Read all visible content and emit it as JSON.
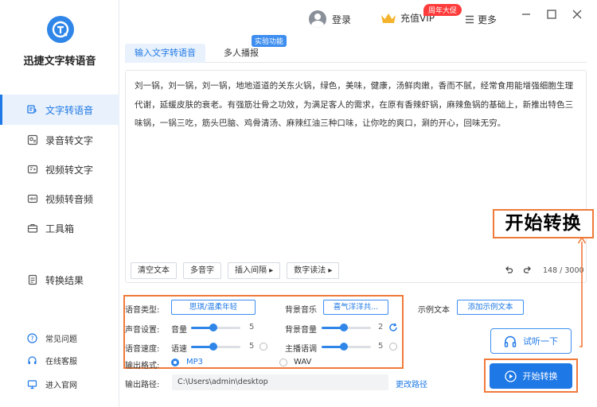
{
  "app": {
    "name": "迅捷文字转语音"
  },
  "sidebar": {
    "items": [
      {
        "label": "文字转语音",
        "active": true
      },
      {
        "label": "录音转文字"
      },
      {
        "label": "视频转文字"
      },
      {
        "label": "视频转音频"
      },
      {
        "label": "工具箱"
      },
      {
        "label": "转换结果"
      }
    ],
    "footer": [
      {
        "label": "常见问题"
      },
      {
        "label": "在线客服"
      },
      {
        "label": "进入官网"
      }
    ]
  },
  "header": {
    "login": "登录",
    "vip": "充值VIP",
    "vip_badge": "周年大促",
    "more": "更多"
  },
  "tabs": [
    {
      "label": "输入文字转语音",
      "active": true
    },
    {
      "label": "多人播报"
    }
  ],
  "lab_badge": "实验功能",
  "editor": {
    "text": "刘一锅，刘一锅，刘一锅，地地道道的关东火锅，绿色，美味，健康，汤鲜肉嫩，香而不腻，经常食用能增强细胞生理代谢，延缓皮肤的衰老。有强筋壮骨之功效，为满足客人的需求，在原有香辣虾锅，麻辣鱼锅的基础上，新推出特色三味锅，一锅三吃，筋头巴脑、鸡骨清汤、麻辣红油三种口味，让你吃的爽口，涮的开心，回味无穷。",
    "tools": [
      "清空文本",
      "多音字",
      "插入间隔 ▸",
      "数字读法 ▸"
    ],
    "char_count": "148 / 3000"
  },
  "settings": {
    "voice_type_label": "语音类型:",
    "voice_type_value": "思琪/温柔年轻",
    "bgm_label": "背景音乐",
    "bgm_value": "喜气洋洋共...",
    "sample_label": "示例文本",
    "sample_button": "添加示例文本",
    "sound_label": "声音设置:",
    "volume_label": "音量",
    "volume_value": "5",
    "bg_volume_label": "背景音量",
    "bg_volume_value": "2",
    "speed_label": "语音速度:",
    "rate_label": "语速",
    "rate_value": "5",
    "pitch_label": "主播语调",
    "pitch_value": "5",
    "format_label": "输出格式:",
    "format_mp3": "MP3",
    "format_wav": "WAV",
    "selected_format": "MP3",
    "volume_level": 0.45,
    "bg_volume_level": 0.45,
    "rate_level": 0.45,
    "pitch_level": 0.45
  },
  "actions": {
    "listen": "试听一下",
    "start": "开始转换",
    "callout": "开始转换"
  },
  "output": {
    "label": "输出路径:",
    "path": "C:\\Users\\admin\\desktop",
    "change": "更改路径"
  },
  "colors": {
    "accent": "#1e78e6",
    "highlight": "#f07a3a"
  }
}
